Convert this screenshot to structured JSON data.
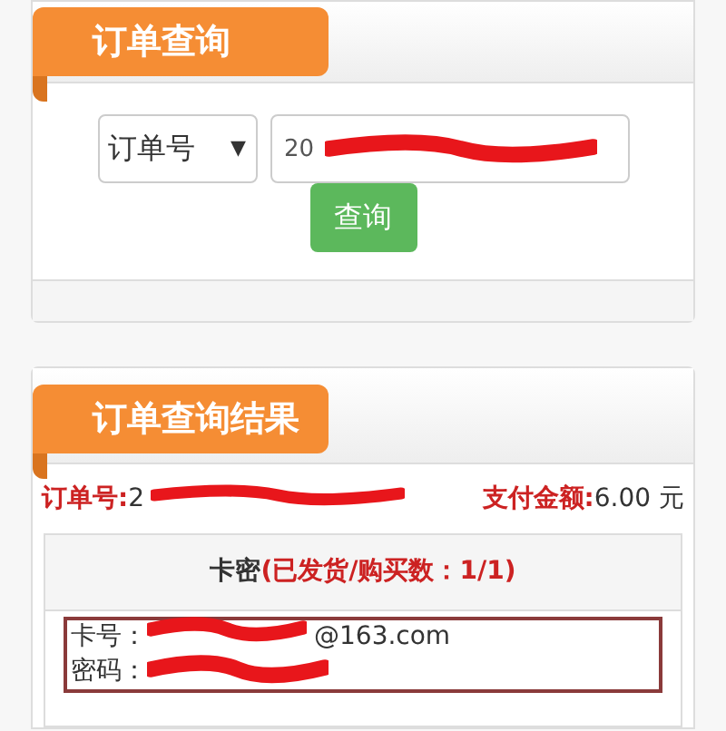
{
  "query_panel": {
    "title": "订单查询",
    "search_type": "订单号",
    "dropdown_arrow": "▼",
    "order_number": "20",
    "submit": "查询"
  },
  "result_panel": {
    "title": "订单查询结果",
    "order_label": "订单号:",
    "order_value": "2",
    "amount_label": "支付金额:",
    "amount_value": "6.00 元",
    "card_header": "卡密",
    "card_status": "(已发货/购买数：1/1)",
    "card_number_label": "卡号：",
    "card_number_value": "@163.com",
    "password_label": "密码："
  }
}
